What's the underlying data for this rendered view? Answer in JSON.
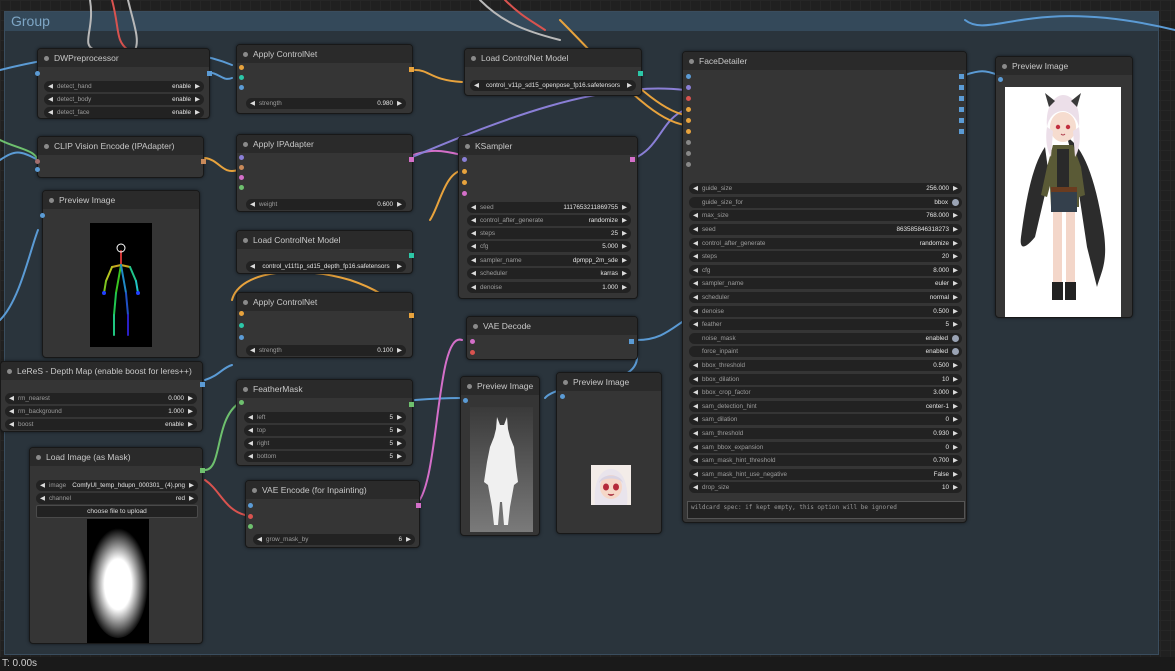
{
  "group": {
    "title": "Group"
  },
  "footer": {
    "timing": "T: 0.00s"
  },
  "nodes": {
    "dwpre": {
      "title": "DWPreprocessor",
      "w": [
        {
          "label": "detect_hand",
          "value": "enable"
        },
        {
          "label": "detect_body",
          "value": "enable"
        },
        {
          "label": "detect_face",
          "value": "enable"
        }
      ]
    },
    "clipvis": {
      "title": "CLIP Vision Encode (IPAdapter)"
    },
    "prev1": {
      "title": "Preview Image"
    },
    "leres": {
      "title": "LeReS - Depth Map (enable boost for leres++)",
      "w": [
        {
          "label": "rm_nearest",
          "value": "0.000"
        },
        {
          "label": "rm_background",
          "value": "1.000"
        },
        {
          "label": "boost",
          "value": "enable"
        }
      ]
    },
    "loadmask": {
      "title": "Load Image (as Mask)",
      "image_label": "image",
      "image_value": "ComfyUI_temp_hdupn_000301_ (4).png",
      "channel_label": "channel",
      "channel_value": "red",
      "upload_label": "choose file to upload"
    },
    "acn1": {
      "title": "Apply ControlNet",
      "w": [
        {
          "label": "strength",
          "value": "0.980"
        }
      ]
    },
    "ipa": {
      "title": "Apply IPAdapter",
      "w": [
        {
          "label": "weight",
          "value": "0.600"
        }
      ]
    },
    "lcn2": {
      "title": "Load ControlNet Model",
      "w": [
        {
          "value": "control_v11f1p_sd15_depth_fp16.safetensors"
        }
      ]
    },
    "acn2": {
      "title": "Apply ControlNet",
      "w": [
        {
          "label": "strength",
          "value": "0.100"
        }
      ]
    },
    "feather": {
      "title": "FeatherMask",
      "w": [
        {
          "label": "left",
          "value": "5"
        },
        {
          "label": "top",
          "value": "5"
        },
        {
          "label": "right",
          "value": "5"
        },
        {
          "label": "bottom",
          "value": "5"
        }
      ]
    },
    "vaeenc": {
      "title": "VAE Encode (for Inpainting)",
      "w": [
        {
          "label": "grow_mask_by",
          "value": "6"
        }
      ]
    },
    "lcn1": {
      "title": "Load ControlNet Model",
      "w": [
        {
          "value": "control_v11p_sd15_openpose_fp16.safetensors"
        }
      ]
    },
    "ksampler": {
      "title": "KSampler",
      "w": [
        {
          "label": "seed",
          "value": "1117653211869755"
        },
        {
          "label": "control_after_generate",
          "value": "randomize"
        },
        {
          "label": "steps",
          "value": "25"
        },
        {
          "label": "cfg",
          "value": "5.000"
        },
        {
          "label": "sampler_name",
          "value": "dpmpp_2m_sde"
        },
        {
          "label": "scheduler",
          "value": "karras"
        },
        {
          "label": "denoise",
          "value": "1.000"
        }
      ]
    },
    "vaedec": {
      "title": "VAE Decode"
    },
    "prev2": {
      "title": "Preview Image"
    },
    "prev3": {
      "title": "Preview Image"
    },
    "face": {
      "title": "FaceDetailer",
      "w": [
        {
          "label": "guide_size",
          "value": "256.000"
        },
        {
          "label": "guide_size_for",
          "value": "bbox"
        },
        {
          "label": "max_size",
          "value": "768.000"
        },
        {
          "label": "seed",
          "value": "863585846318273"
        },
        {
          "label": "control_after_generate",
          "value": "randomize"
        },
        {
          "label": "steps",
          "value": "20"
        },
        {
          "label": "cfg",
          "value": "8.000"
        },
        {
          "label": "sampler_name",
          "value": "euler"
        },
        {
          "label": "scheduler",
          "value": "normal"
        },
        {
          "label": "denoise",
          "value": "0.500"
        },
        {
          "label": "feather",
          "value": "5"
        },
        {
          "label": "noise_mask",
          "value": "enabled"
        },
        {
          "label": "force_inpaint",
          "value": "enabled"
        },
        {
          "label": "bbox_threshold",
          "value": "0.500"
        },
        {
          "label": "bbox_dilation",
          "value": "10"
        },
        {
          "label": "bbox_crop_factor",
          "value": "3.000"
        },
        {
          "label": "sam_detection_hint",
          "value": "center-1"
        },
        {
          "label": "sam_dilation",
          "value": "0"
        },
        {
          "label": "sam_threshold",
          "value": "0.930"
        },
        {
          "label": "sam_bbox_expansion",
          "value": "0"
        },
        {
          "label": "sam_mask_hint_threshold",
          "value": "0.700"
        },
        {
          "label": "sam_mask_hint_use_negative",
          "value": "False"
        },
        {
          "label": "drop_size",
          "value": "10"
        }
      ],
      "wildcard": "wildcard spec: if kept empty, this option will be ignored"
    },
    "prev4": {
      "title": "Preview Image"
    }
  },
  "colors": {
    "group_bg": "#2a343c",
    "group_header": "#34495a",
    "node_bg": "#353535",
    "node_header": "#2a2a2a",
    "widget_bg": "#222222",
    "wire_blue": "#5b9bd5",
    "wire_orange": "#e8a33d",
    "wire_pink": "#d46fc9",
    "wire_purple": "#8a7fd6",
    "wire_red": "#d9534f",
    "wire_green": "#6ec06e",
    "wire_gray": "#b9b9b9"
  }
}
